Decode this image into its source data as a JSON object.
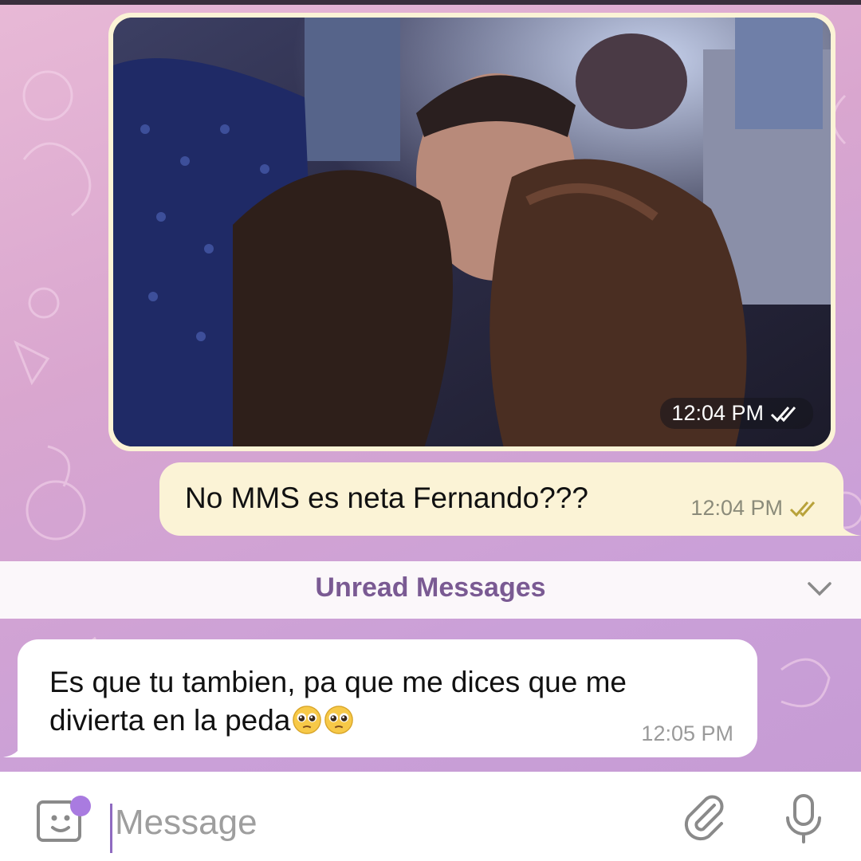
{
  "photo_message": {
    "time": "12:04 PM",
    "status_icon": "double-check-icon"
  },
  "outgoing_message": {
    "text": "No MMS es neta Fernando???",
    "time": "12:04 PM",
    "status_icon": "double-check-icon"
  },
  "unread_divider": {
    "label": "Unread Messages",
    "icon": "chevron-down-icon"
  },
  "incoming_message": {
    "line1": "Es que tu tambien, pa que me dices que me",
    "line2": "divierta en la peda",
    "emoji": [
      "pleading-face-emoji",
      "pleading-face-emoji"
    ],
    "time": "12:05 PM"
  },
  "composer": {
    "placeholder": "Message",
    "value": "",
    "left_icon": "sticker-icon",
    "right_icons": [
      "paperclip-icon",
      "microphone-icon"
    ]
  },
  "colors": {
    "outgoing_bubble": "#fbf3d6",
    "incoming_bubble": "#ffffff",
    "unread_label": "#7a5a93",
    "accent": "#a97be0"
  }
}
